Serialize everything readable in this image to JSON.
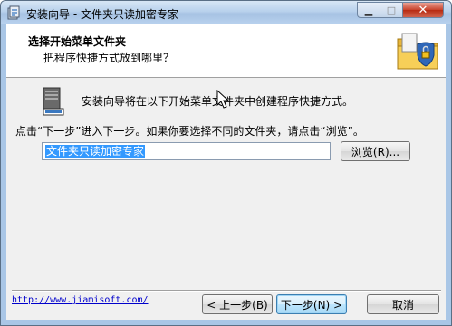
{
  "window": {
    "title": "安装向导 - 文件夹只读加密专家",
    "icons": [
      "installer-app-icon",
      "minimize-icon",
      "maximize-icon",
      "close-icon"
    ]
  },
  "header": {
    "title": "选择开始菜单文件夹",
    "subtitle": "把程序快捷方式放到哪里？",
    "image_icon": "folder-lock-shield-icon"
  },
  "body": {
    "icon": "computer-tower-icon",
    "line1": "安装向导将在以下开始菜单文件夹中创建程序快捷方式。",
    "line2": "点击“下一步”进入下一步。如果你要选择不同的文件夹，请点击“浏览”。",
    "folder_value": "文件夹只读加密专家",
    "browse_label": "浏览(R)..."
  },
  "footer": {
    "link": "http://www.jiamisoft.com/",
    "back_label": "< 上一步(B)",
    "next_label": "下一步(N) >",
    "cancel_label": "取消"
  }
}
